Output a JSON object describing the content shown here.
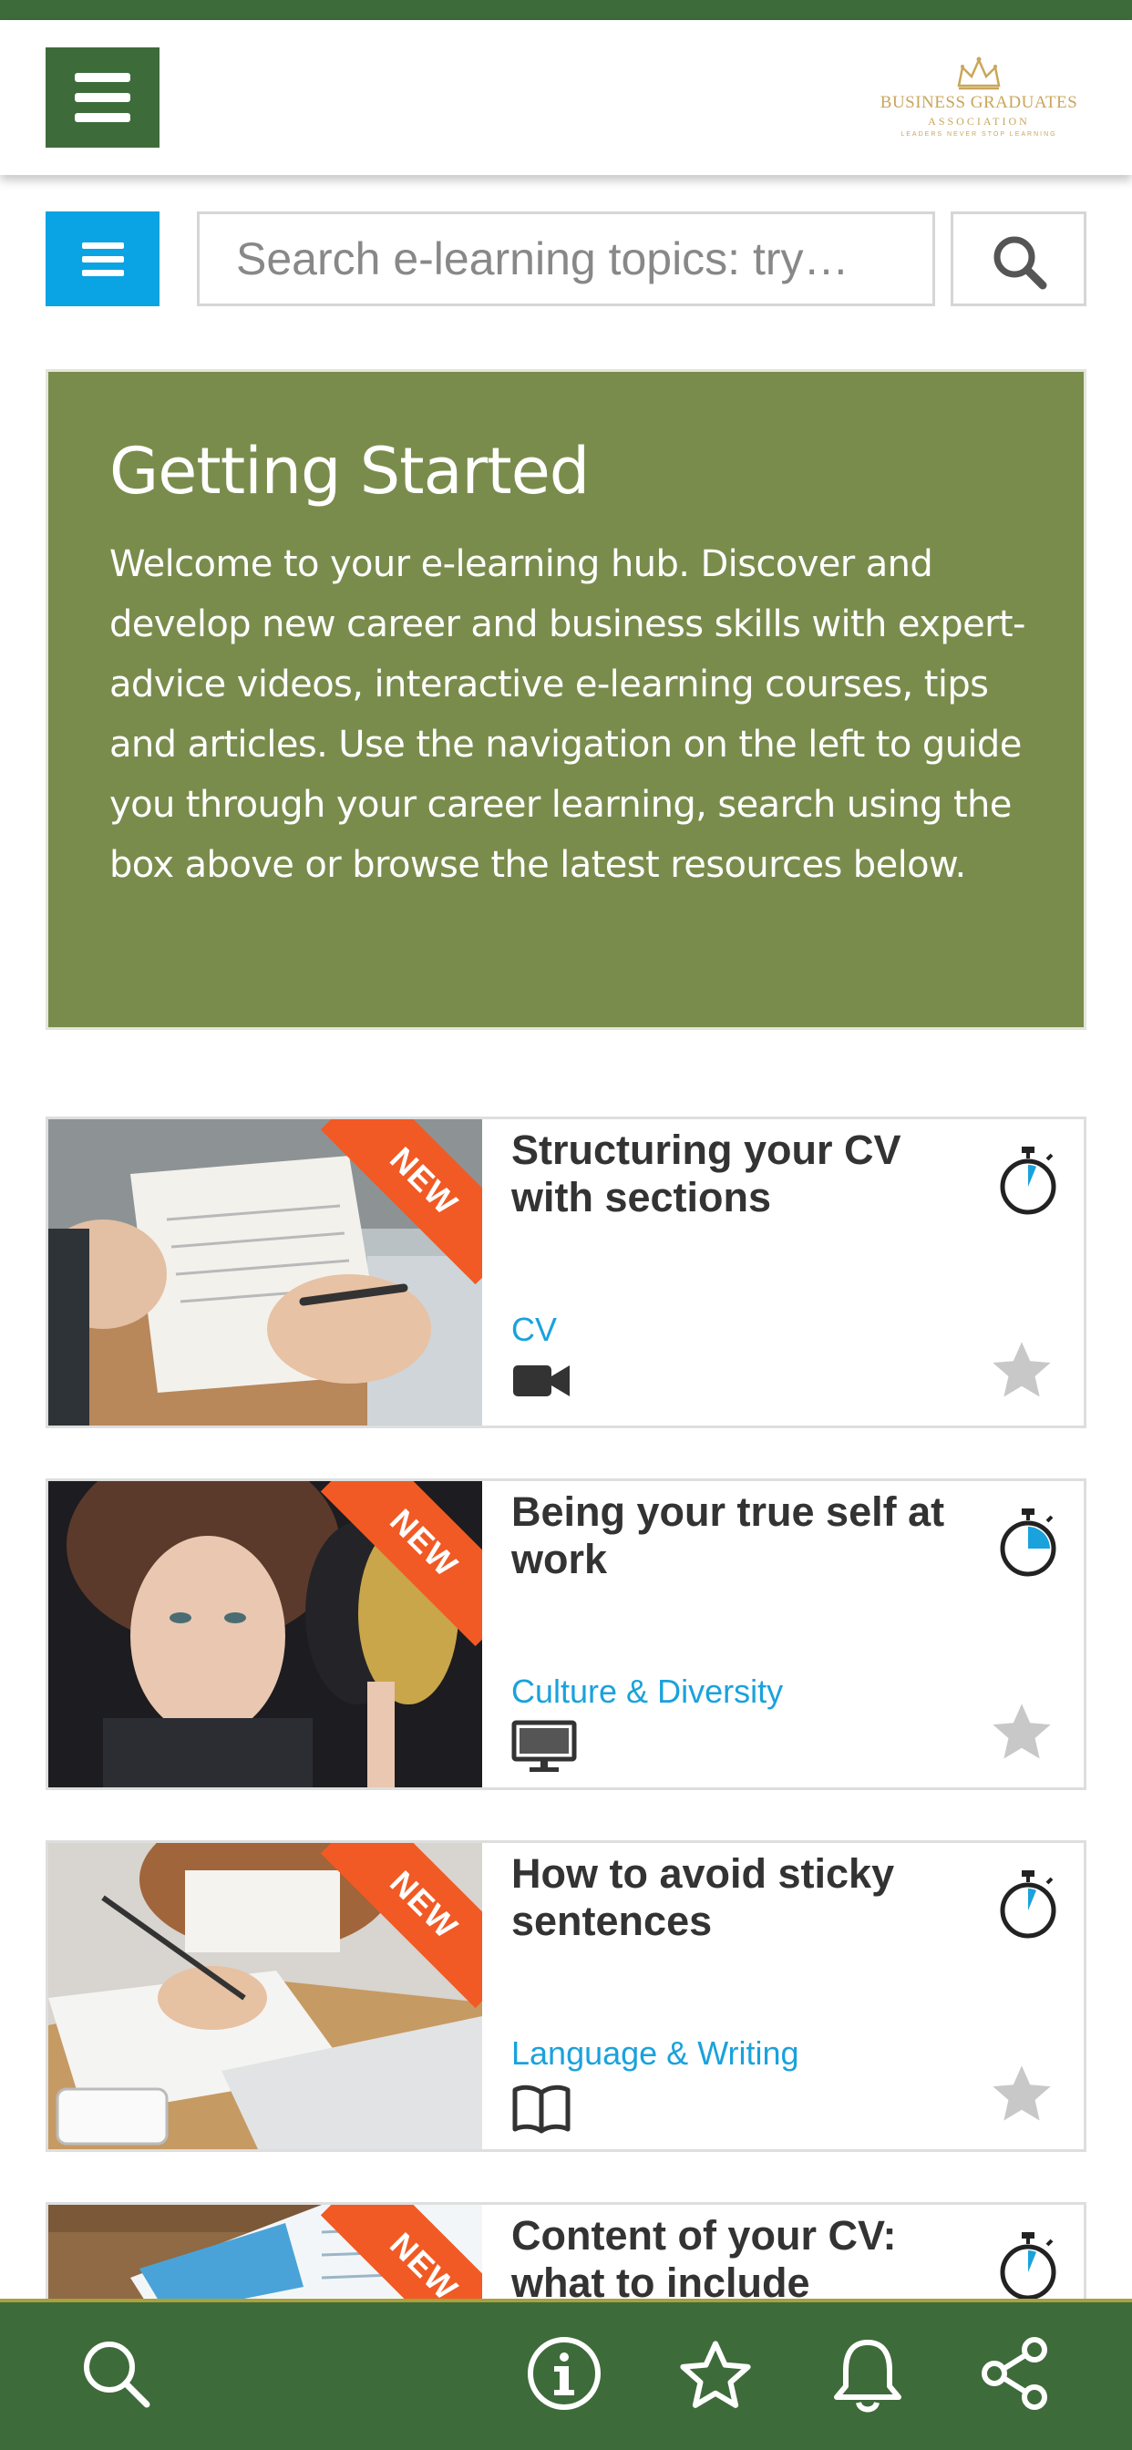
{
  "header": {
    "logo_line1": "BUSINESS GRADUATES",
    "logo_line2": "ASSOCIATION",
    "logo_line3": "LEADERS NEVER STOP LEARNING"
  },
  "search": {
    "placeholder": "Search e-learning topics: try…"
  },
  "hero": {
    "title": "Getting Started",
    "body": "Welcome to your e-learning hub. Discover and develop new career and business skills with expert-advice videos, interactive e-learning courses, tips and articles. Use the navigation on the left to guide you through your career learning, search using the box above or browse the latest resources below."
  },
  "cards": [
    {
      "badge": "NEW",
      "title": "Structuring your CV with sections",
      "category": "CV",
      "type_icon": "video-camera-icon"
    },
    {
      "badge": "NEW",
      "title": "Being your true self at work",
      "category": "Culture & Diversity",
      "type_icon": "monitor-icon"
    },
    {
      "badge": "NEW",
      "title": "How to avoid sticky sentences",
      "category": "Language & Writing",
      "type_icon": "book-icon"
    },
    {
      "badge": "NEW",
      "title": "Content of your CV: what to include",
      "category": "",
      "type_icon": ""
    }
  ],
  "bottom_nav": [
    "search-icon",
    "info-icon",
    "star-icon",
    "bell-icon",
    "share-icon"
  ],
  "colors": {
    "brand_green": "#3e6b3a",
    "hero_olive": "#7a8c4c",
    "accent_blue": "#0aa3e3",
    "badge_orange": "#f15a24",
    "logo_gold": "#c9a65a"
  }
}
